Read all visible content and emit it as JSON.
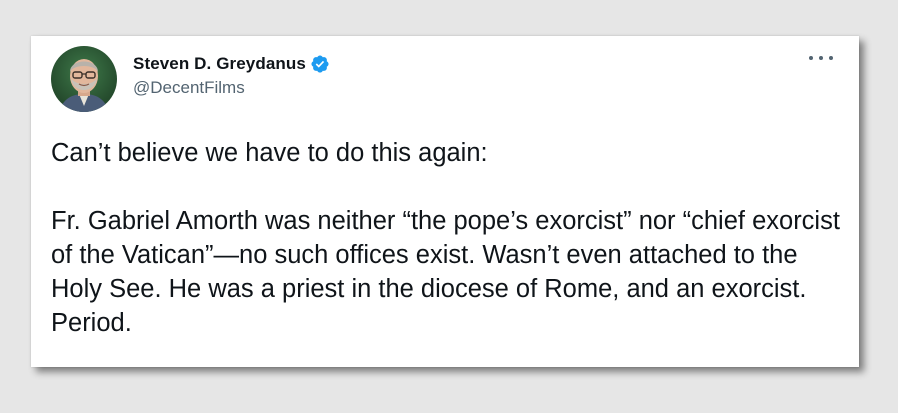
{
  "tweet": {
    "author": {
      "display_name": "Steven D. Greydanus",
      "handle": "@DecentFilms",
      "verified": true,
      "avatar_icon": "profile-photo",
      "verified_icon": "verified-badge-icon"
    },
    "more_icon": "more-options-icon",
    "text_paragraphs": [
      "Can’t believe we have to do this again:",
      "Fr. Gabriel Amorth was neither “the pope’s exorcist” nor “chief exorcist of the Vatican”—no such offices exist. Wasn’t even attached to the Holy See. He was a priest in the diocese of Rome, and an exorcist. Period."
    ]
  },
  "colors": {
    "background": "#e6e6e6",
    "card": "#ffffff",
    "text": "#0f1419",
    "secondary_text": "#536471",
    "verified_blue": "#1d9bf0"
  }
}
